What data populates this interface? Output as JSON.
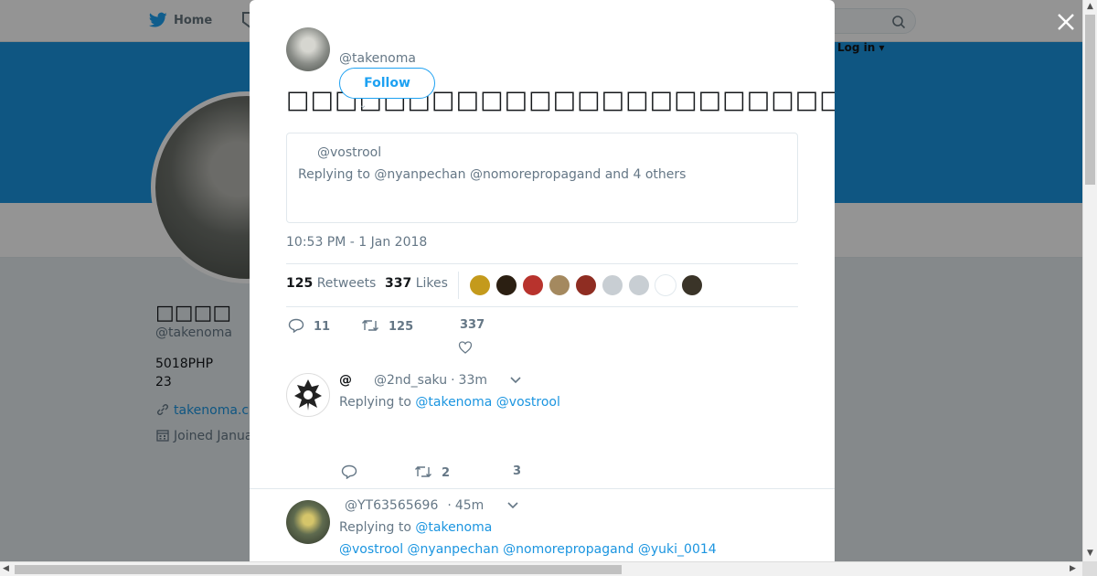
{
  "nav": {
    "home_label": "Home",
    "login_label": "Log in ▾"
  },
  "profile": {
    "display_name": "□□□□",
    "handle": "@takenoma",
    "bio_line1": "5018PHP",
    "bio_line2": "23",
    "url": "takenoma.c",
    "joined": "Joined Janua"
  },
  "tweet": {
    "author_handle": "@takenoma",
    "follow_label": "Follow",
    "text": "□□□□□□□□□□□□□□□□□□□□□□□□□□□□□□□□□□□□□□□□□□□□",
    "quoted": {
      "handle": "@vostrool",
      "replying_to": "Replying to @nyanpechan @nomorepropagand and 4 others"
    },
    "timestamp": "10:53 PM - 1 Jan 2018",
    "retweets_count": "125",
    "retweets_label": "Retweets",
    "likes_count": "337",
    "likes_label": "Likes",
    "actions": {
      "reply_count": "11",
      "retweet_count": "125",
      "like_count": "337"
    },
    "likers": [
      {
        "color": "#c49a1c"
      },
      {
        "color": "#2b1f12"
      },
      {
        "color": "#b8332d"
      },
      {
        "color": "#a4895f"
      },
      {
        "color": "#8f2d22"
      },
      {
        "color": "#c8ced3"
      },
      {
        "color": "#c8ced3"
      },
      {
        "color": "#ffffff"
      },
      {
        "color": "#3a3428"
      }
    ]
  },
  "replies": [
    {
      "name": "@",
      "handle": "@2nd_saku",
      "time": "33m",
      "replying_label": "Replying to",
      "mentions": "@takenoma @vostrool",
      "mentions_line2": "",
      "retweet_count": "2",
      "like_count": "3",
      "avatar_color": "#ffffff"
    },
    {
      "name": "",
      "handle": "@YT63565696",
      "time": "45m",
      "replying_label": "Replying to",
      "mentions": "@takenoma",
      "mentions_line2": "@vostrool @nyanpechan @nomorepropagand @yuki_0014",
      "avatar_color": "#5f6b4f"
    }
  ]
}
